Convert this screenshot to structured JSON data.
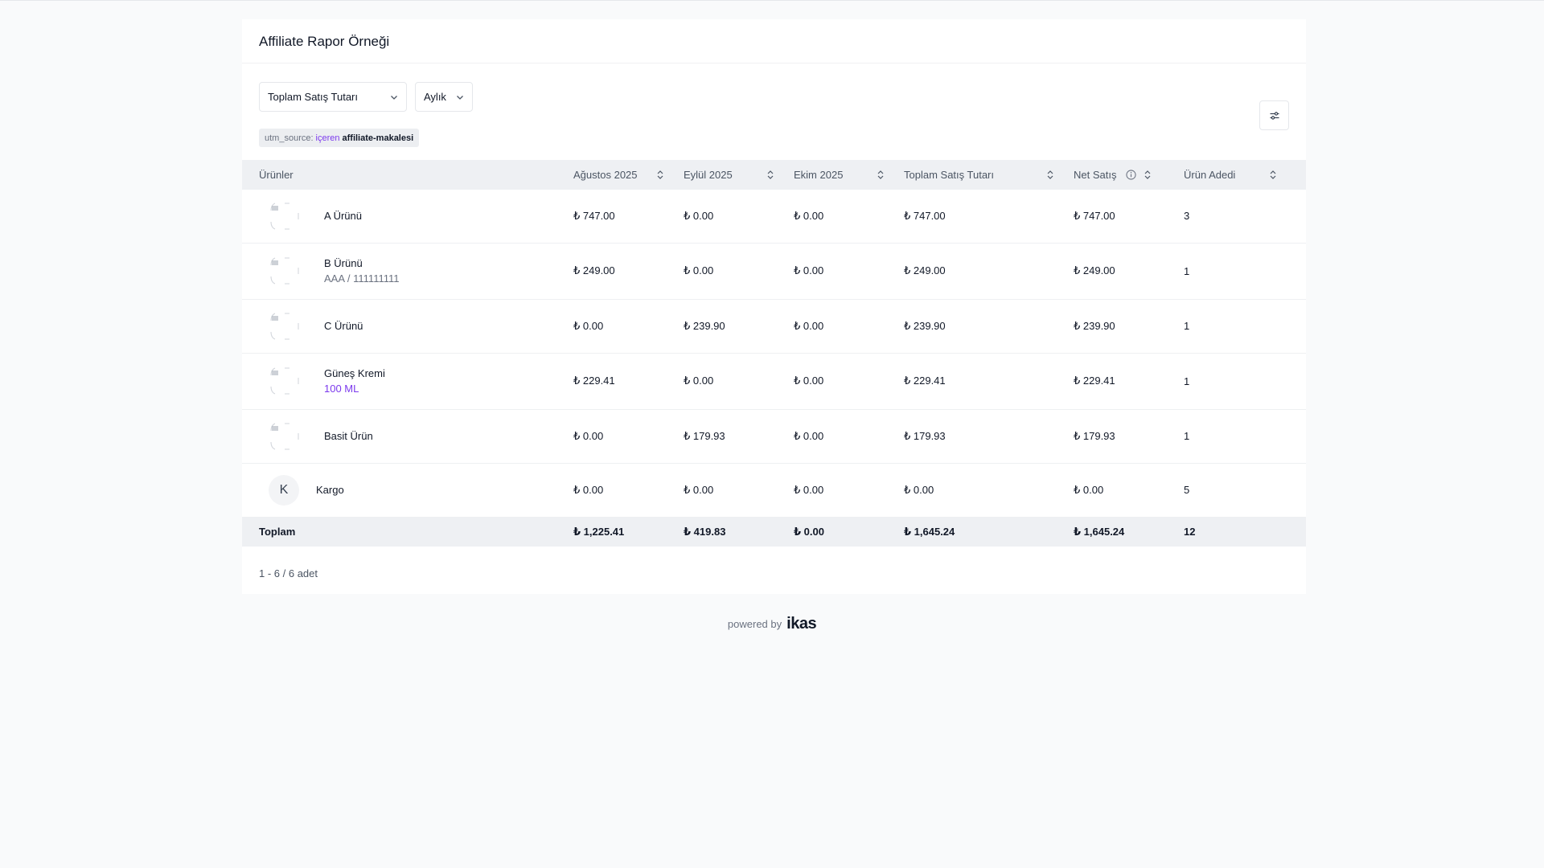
{
  "report": {
    "title": "Affiliate Rapor Örneği"
  },
  "filters": {
    "metric": "Toplam Satış Tutarı",
    "period": "Aylık",
    "chip": {
      "key": "utm_source:",
      "op": "içeren",
      "value": "affiliate-makalesi"
    }
  },
  "table": {
    "headers": {
      "products": "Ürünler",
      "aug": "Ağustos 2025",
      "sep": "Eylül 2025",
      "oct": "Ekim 2025",
      "total": "Toplam Satış Tutarı",
      "net": "Net Satış",
      "qty": "Ürün Adedi"
    },
    "rows": [
      {
        "name": "A Ürünü",
        "sub": "",
        "aug": "₺ 747.00",
        "sep": "₺ 0.00",
        "oct": "₺ 0.00",
        "total": "₺ 747.00",
        "net": "₺ 747.00",
        "qty": "3"
      },
      {
        "name": "B Ürünü",
        "sub": "AAA / 111111111",
        "aug": "₺ 249.00",
        "sep": "₺ 0.00",
        "oct": "₺ 0.00",
        "total": "₺ 249.00",
        "net": "₺ 249.00",
        "qty": "1"
      },
      {
        "name": "C Ürünü",
        "sub": "",
        "aug": "₺ 0.00",
        "sep": "₺ 239.90",
        "oct": "₺ 0.00",
        "total": "₺ 239.90",
        "net": "₺ 239.90",
        "qty": "1"
      },
      {
        "name": "Güneş Kremi",
        "sub": "100 ML",
        "aug": "₺ 229.41",
        "sep": "₺ 0.00",
        "oct": "₺ 0.00",
        "total": "₺ 229.41",
        "net": "₺ 229.41",
        "qty": "1"
      },
      {
        "name": "Basit Ürün",
        "sub": "",
        "aug": "₺ 0.00",
        "sep": "₺ 179.93",
        "oct": "₺ 0.00",
        "total": "₺ 179.93",
        "net": "₺ 179.93",
        "qty": "1"
      },
      {
        "name": "Kargo",
        "avatar": "K",
        "sub": "",
        "aug": "₺ 0.00",
        "sep": "₺ 0.00",
        "oct": "₺ 0.00",
        "total": "₺ 0.00",
        "net": "₺ 0.00",
        "qty": "5"
      }
    ],
    "footer": {
      "label": "Toplam",
      "aug": "₺ 1,225.41",
      "sep": "₺ 419.83",
      "oct": "₺ 0.00",
      "total": "₺ 1,645.24",
      "net": "₺ 1,645.24",
      "qty": "12"
    }
  },
  "pagination": {
    "text": "1 - 6 / 6 adet"
  },
  "footer": {
    "powered": "powered by",
    "brand": "ikas"
  },
  "colors": {
    "accent": "#7c3aed",
    "header_bg": "#eef0f3",
    "page_bg": "#f9fafb"
  },
  "icons": {
    "sort": "sort-icon",
    "chevron": "chevron-down-icon",
    "settings": "sliders-icon",
    "info": "info-icon",
    "image": "broken-image-icon"
  }
}
